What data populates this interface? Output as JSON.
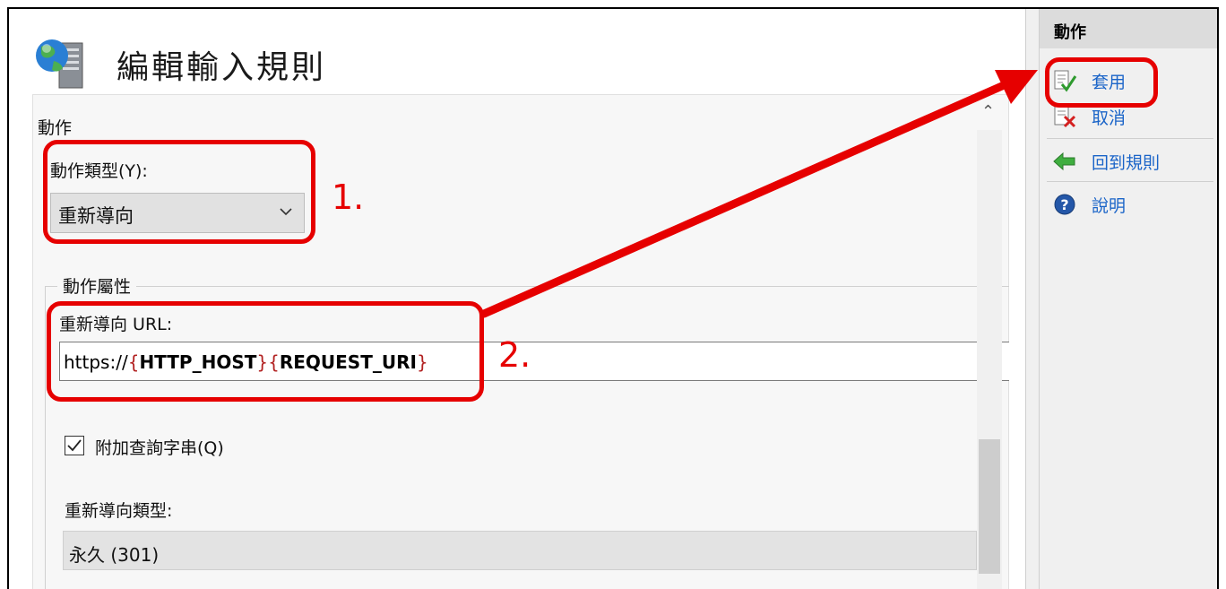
{
  "main": {
    "title": "編輯輸入規則",
    "section_title": "動作",
    "action_type_label": "動作類型(Y):",
    "action_type_value": "重新導向",
    "properties_group_label": "動作屬性",
    "redirect_url_label": "重新導向 URL:",
    "redirect_url": {
      "p1": "https://",
      "b1": "{",
      "v1": "HTTP_HOST",
      "b2": "}",
      "b3": "{",
      "v2": "REQUEST_URI",
      "b4": "}"
    },
    "append_query_label": "附加查詢字串(Q)",
    "append_query_checked": true,
    "redirect_type_label": "重新導向類型:",
    "redirect_type_value": "永久 (301)"
  },
  "actions_pane": {
    "header": "動作",
    "items": [
      {
        "label": "套用",
        "icon": "apply-icon"
      },
      {
        "label": "取消",
        "icon": "cancel-icon"
      },
      {
        "label": "回到規則",
        "icon": "back-arrow-icon"
      },
      {
        "label": "說明",
        "icon": "help-icon"
      }
    ]
  },
  "annotations": {
    "step1": "1.",
    "step2": "2.",
    "color": "#e60000"
  },
  "colors": {
    "link": "#1a64c8",
    "accent_red": "#e60000"
  }
}
